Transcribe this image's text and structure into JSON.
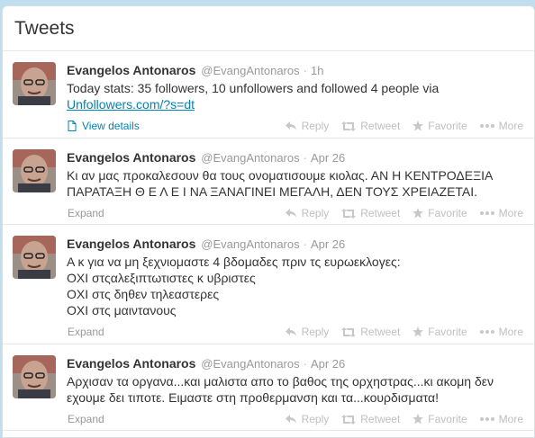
{
  "header": {
    "title": "Tweets"
  },
  "actions": {
    "reply": "Reply",
    "retweet": "Retweet",
    "favorite": "Favorite",
    "more": "More"
  },
  "tweets": [
    {
      "fullname": "Evangelos Antonaros",
      "username": "@EvangAntonaros",
      "time": "1h",
      "lines": [
        "Today stats: 35 followers, 10 unfollowers and followed 4 people via"
      ],
      "link": "Unfollowers.com/?s=dt",
      "footer_label": "View details"
    },
    {
      "fullname": "Evangelos Antonaros",
      "username": "@EvangAntonaros",
      "time": "Apr 26",
      "lines": [
        "Κι αν μας προκαλεσουν θα τους ονοματισουμε κιολας. ΑΝ Η ΚΕΝΤΡΟΔΕΞΙΑ",
        "ΠΑΡΑΤΑΞΗ Θ Ε Λ Ε Ι ΝΑ ΞΑΝΑΓΙΝΕΙ ΜΕΓΑΛΗ, ΔΕΝ ΤΟΥΣ ΧΡΕΙΑΖΕΤΑΙ."
      ],
      "footer_label": "Expand"
    },
    {
      "fullname": "Evangelos Antonaros",
      "username": "@EvangAntonaros",
      "time": "Apr 26",
      "lines": [
        "Α κ για να μη ξεχνιομαστε 4 βδομαδες πριν τς ευρωεκλογες:",
        "ΟΧΙ στςαλεξιπτωτιστες κ υβριστες",
        "ΟΧΙ στς  δηθεν τηλεαστερες",
        "ΟΧΙ στς μαιντανους"
      ],
      "footer_label": "Expand"
    },
    {
      "fullname": "Evangelos Antonaros",
      "username": "@EvangAntonaros",
      "time": "Apr 26",
      "lines": [
        "Αρχισαν τα οργανα...και μαλιστα απο το βαθος της ορχηστρας...κι ακομη δεν",
        "εχουμε δει τιποτε. Ειμαστε στη προθερμανση και τα...κουρδισματα!"
      ],
      "footer_label": "Expand"
    }
  ],
  "colors": {
    "link": "#0084b4",
    "background": "#c0deed"
  }
}
